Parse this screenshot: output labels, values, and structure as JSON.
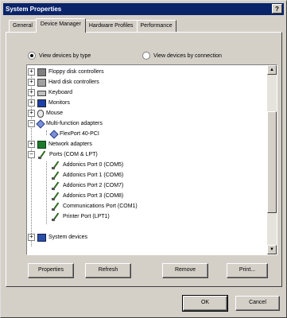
{
  "window": {
    "title": "System Properties",
    "help_glyph": "?"
  },
  "tabs": [
    {
      "label": "General"
    },
    {
      "label": "Device Manager",
      "active": true
    },
    {
      "label": "Hardware Profiles"
    },
    {
      "label": "Performance"
    }
  ],
  "view_options": {
    "by_type": {
      "label": "View devices by type",
      "selected": true
    },
    "by_connection": {
      "label": "View devices by connection",
      "selected": false
    }
  },
  "tree": [
    {
      "label": "Floppy disk controllers",
      "level": 0,
      "expander": "+",
      "icon": "floppy-icon"
    },
    {
      "label": "Hard disk controllers",
      "level": 0,
      "expander": "+",
      "icon": "hard-disk-icon"
    },
    {
      "label": "Keyboard",
      "level": 0,
      "expander": "+",
      "icon": "keyboard-icon"
    },
    {
      "label": "Monitors",
      "level": 0,
      "expander": "+",
      "icon": "monitor-icon"
    },
    {
      "label": "Mouse",
      "level": 0,
      "expander": "+",
      "icon": "mouse-icon"
    },
    {
      "label": "Multi-function adapters",
      "level": 0,
      "expander": "−",
      "icon": "multi-function-icon"
    },
    {
      "label": "FlexPort 40-PCI",
      "level": 1,
      "icon": "multi-function-icon"
    },
    {
      "label": "Network adapters",
      "level": 0,
      "expander": "+",
      "icon": "network-icon"
    },
    {
      "label": "Ports (COM & LPT)",
      "level": 0,
      "expander": "−",
      "icon": "port-icon"
    },
    {
      "label": "Addonics Port 0 (COM5)",
      "level": 1,
      "icon": "port-icon"
    },
    {
      "label": "Addonics Port 1 (COM6)",
      "level": 1,
      "icon": "port-icon"
    },
    {
      "label": "Addonics Port 2 (COM7)",
      "level": 1,
      "icon": "port-icon"
    },
    {
      "label": "Addonics Port 3 (COM8)",
      "level": 1,
      "icon": "port-icon"
    },
    {
      "label": "Communications Port (COM1)",
      "level": 1,
      "icon": "port-icon"
    },
    {
      "label": "Printer Port (LPT1)",
      "level": 1,
      "icon": "port-icon"
    },
    {
      "label": "System devices",
      "level": 0,
      "expander": "+",
      "icon": "system-devices-icon"
    }
  ],
  "scrollbar": {
    "up_glyph": "▲",
    "down_glyph": "▼"
  },
  "actions": {
    "properties": "Properties",
    "refresh": "Refresh",
    "remove": "Remove",
    "print": "Print..."
  },
  "dialog": {
    "ok": "OK",
    "cancel": "Cancel"
  }
}
